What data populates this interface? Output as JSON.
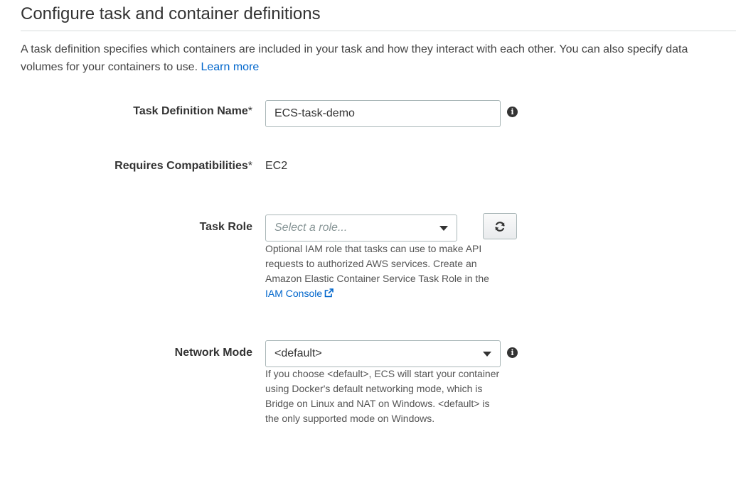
{
  "header": {
    "title": "Configure task and container definitions",
    "intro_text": "A task definition specifies which containers are included in your task and how they interact with each other. You can also specify data volumes for your containers to use.",
    "learn_more_label": "Learn more"
  },
  "task_definition_name": {
    "label": "Task Definition Name",
    "required_marker": "*",
    "value": "ECS-task-demo",
    "icon": "info-icon"
  },
  "requires_compatibilities": {
    "label": "Requires Compatibilities",
    "required_marker": "*",
    "value": "EC2"
  },
  "task_role": {
    "label": "Task Role",
    "placeholder": "Select a role...",
    "refresh_icon": "refresh-icon",
    "help_text": "Optional IAM role that tasks can use to make API requests to authorized AWS services. Create an Amazon Elastic Container Service Task Role in the",
    "help_link_label": "IAM Console",
    "help_link_icon": "external-link-icon"
  },
  "network_mode": {
    "label": "Network Mode",
    "value": "<default>",
    "icon": "info-icon",
    "help_text": "If you choose <default>, ECS will start your container using Docker's default networking mode, which is Bridge on Linux and NAT on Windows. <default> is the only supported mode on Windows."
  },
  "colors": {
    "link": "#0066cc",
    "border": "#aab7b8",
    "text": "#333333"
  }
}
